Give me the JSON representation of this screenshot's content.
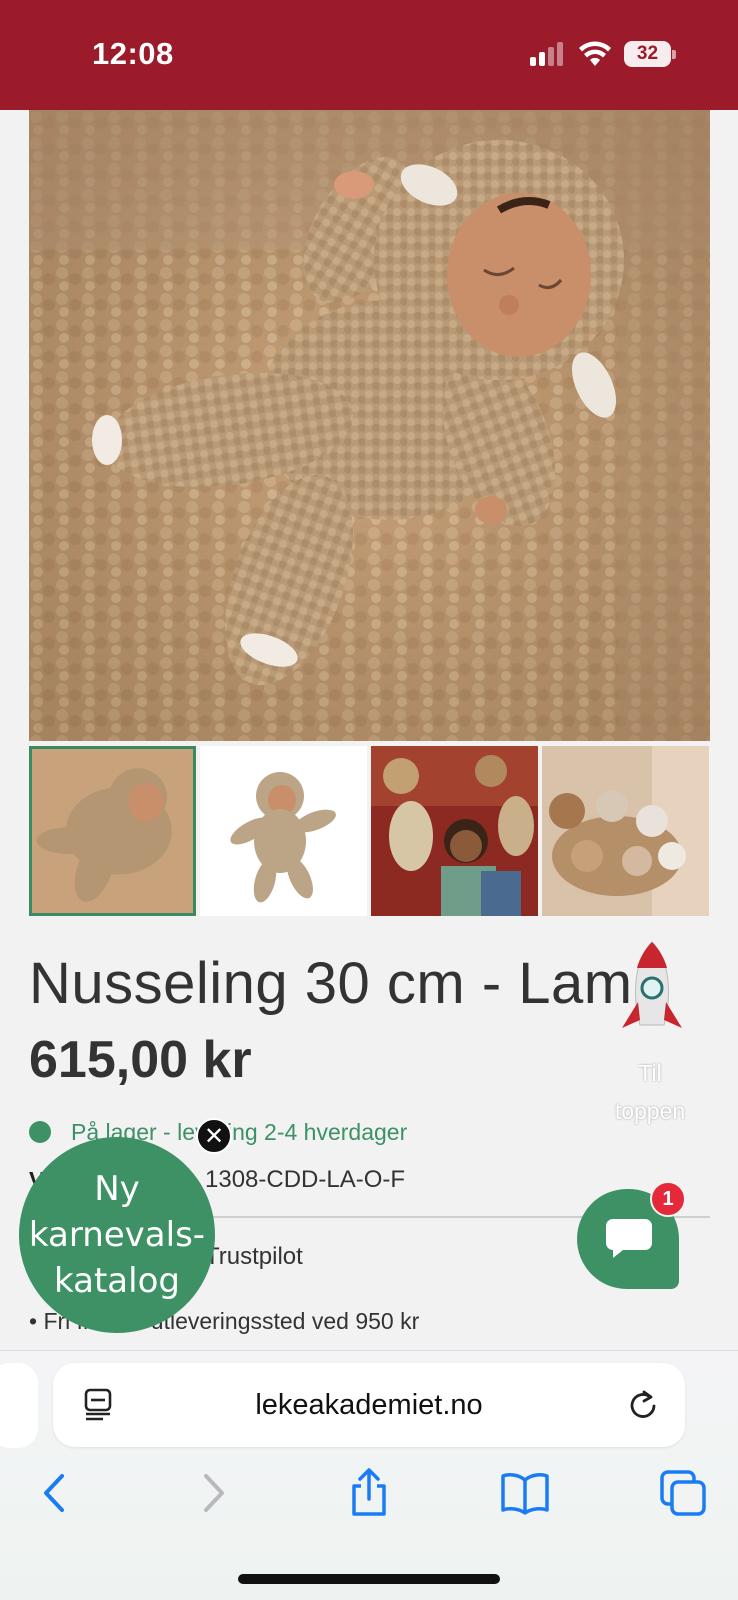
{
  "status_bar": {
    "time": "12:08",
    "battery": "32",
    "bar_color": "#9b1b2a"
  },
  "product": {
    "title": "Nusseling 30 cm - Lam",
    "price": "615,00 kr",
    "stock": "På lager - levering 2-4 hverdager",
    "sku_label": "V",
    "sku": "1308-CDD-LA-O-F",
    "trustpilot": "Trustpilot",
    "shipping": "• Fri frakt til utleveringssted ved 950 kr",
    "accent_color": "#3d9165"
  },
  "gallery": {
    "thumbnails": [
      "thumbnail-1",
      "thumbnail-2",
      "thumbnail-3",
      "thumbnail-4"
    ],
    "selected_index": 0
  },
  "scroll_top": {
    "label_line1": "Til",
    "label_line2": "toppen",
    "icon": "rocket-icon"
  },
  "promo": {
    "line1": "Ny",
    "line2": "karnevals-",
    "line3": "katalog",
    "close_icon": "close-icon"
  },
  "chat": {
    "badge_count": "1",
    "icon": "chat-bubble-icon"
  },
  "browser": {
    "url": "lekeakademiet.no",
    "icons": [
      "reader-icon",
      "reload-icon",
      "back-icon",
      "forward-icon",
      "share-icon",
      "bookmarks-icon",
      "tabs-icon"
    ]
  }
}
